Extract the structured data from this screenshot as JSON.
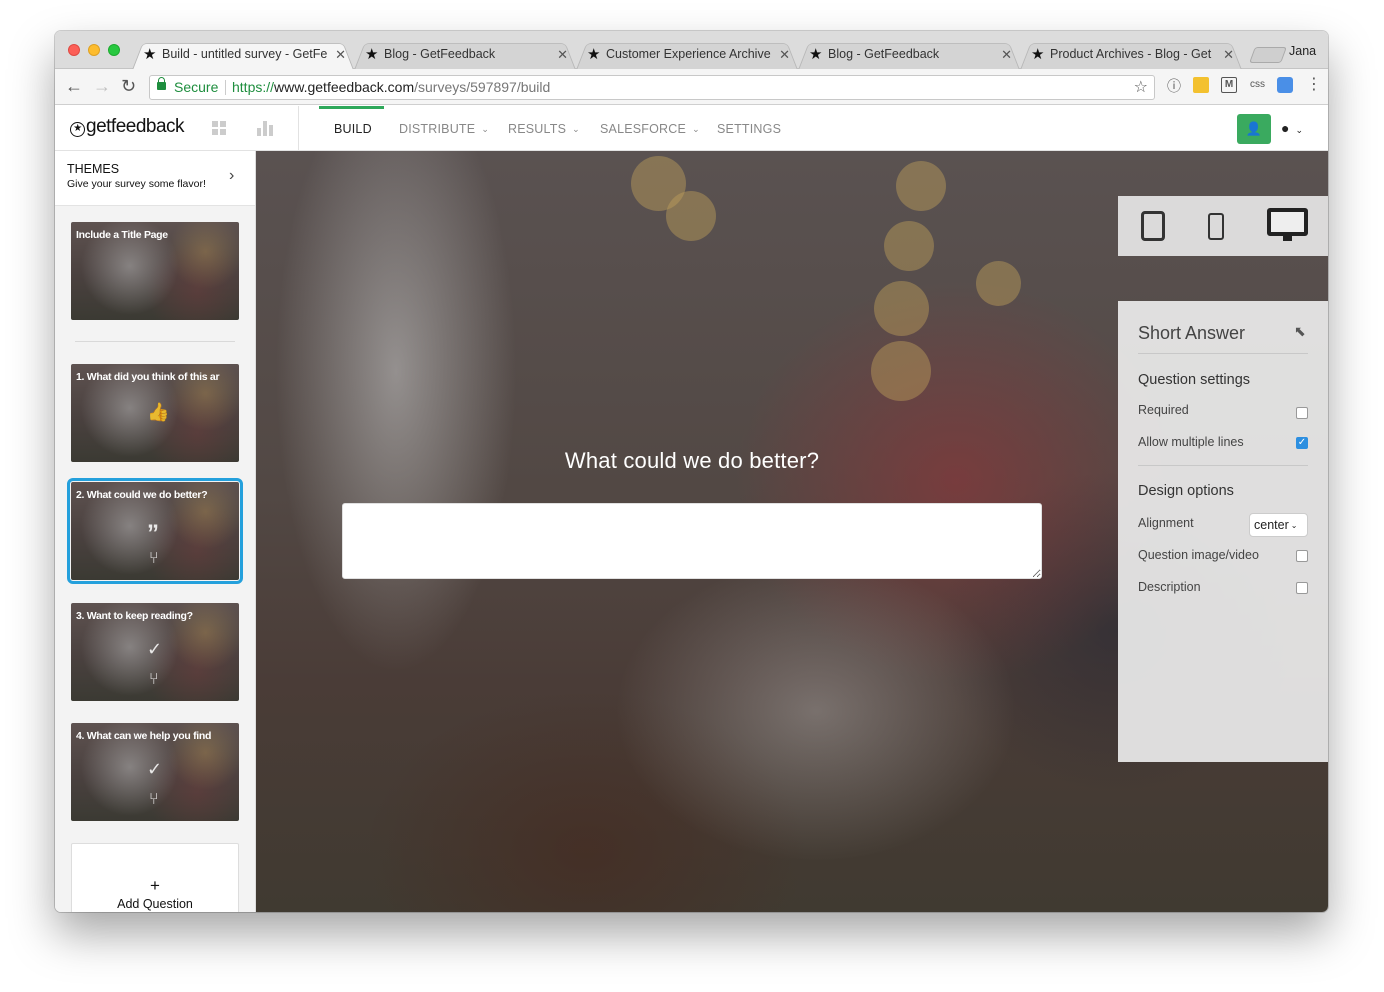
{
  "browser": {
    "tabs": [
      {
        "title": "Build - untitled survey - GetFe",
        "active": true
      },
      {
        "title": "Blog - GetFeedback",
        "active": false
      },
      {
        "title": "Customer Experience Archive",
        "active": false
      },
      {
        "title": "Blog - GetFeedback",
        "active": false
      },
      {
        "title": "Product Archives - Blog - Get",
        "active": false
      }
    ],
    "profile_name": "Jana",
    "secure_label": "Secure",
    "url_protocol": "https://",
    "url_host": "www.getfeedback.com",
    "url_path": "/surveys/597897/build",
    "ext_css_label": "css"
  },
  "app": {
    "logo_text": "getfeedback",
    "nav": {
      "build": "BUILD",
      "distribute": "DISTRIBUTE",
      "results": "RESULTS",
      "salesforce": "SALESFORCE",
      "settings": "SETTINGS"
    },
    "accent_color": "#3aaa5f"
  },
  "sidebar": {
    "themes_title": "THEMES",
    "themes_subtitle": "Give your survey some flavor!",
    "cards": [
      {
        "title": "Include a Title Page",
        "icon": "none"
      },
      {
        "title": "1. What did you think of this ar",
        "icon": "thumbs-up-icon"
      },
      {
        "title": "2. What could we do better?",
        "icon": "quote-icon",
        "selected": true
      },
      {
        "title": "3. Want to keep reading?",
        "icon": "check-icon"
      },
      {
        "title": "4. What can we help you find",
        "icon": "check-icon"
      }
    ],
    "add_question_label": "Add Question",
    "selected_color": "#24a0dc"
  },
  "canvas": {
    "question_text": "What could we do better?",
    "answer_value": ""
  },
  "settings_panel": {
    "title": "Short Answer",
    "question_settings_heading": "Question settings",
    "required_label": "Required",
    "required_checked": false,
    "multiline_label": "Allow multiple lines",
    "multiline_checked": true,
    "design_options_heading": "Design options",
    "alignment_label": "Alignment",
    "alignment_value": "center",
    "image_video_label": "Question image/video",
    "image_video_checked": false,
    "description_label": "Description",
    "description_checked": false
  }
}
